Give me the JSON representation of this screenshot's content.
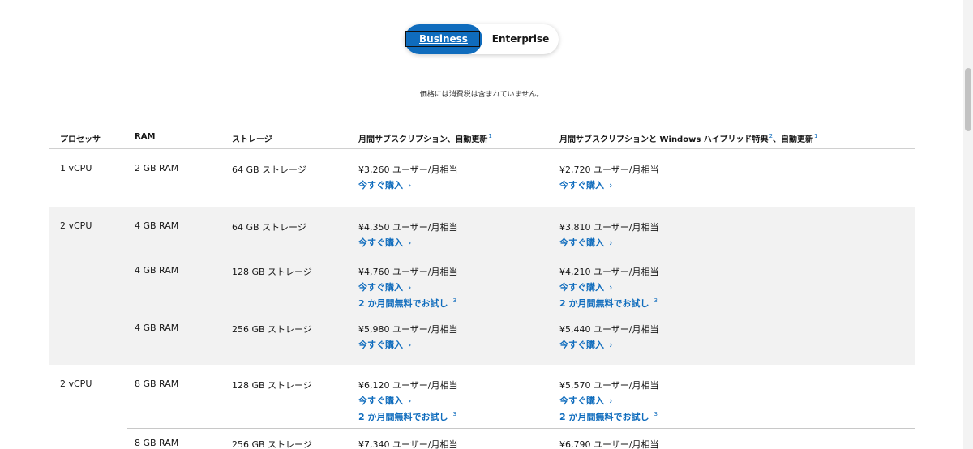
{
  "toggle": {
    "business_label": "Business",
    "enterprise_label": "Enterprise"
  },
  "note": "価格には消費税は含まれていません。",
  "table": {
    "headers": {
      "processor": "プロセッサ",
      "ram": "RAM",
      "storage": "ストレージ",
      "monthly": "月間サブスクリプション、自動更新",
      "monthly_sup": "1",
      "hybrid": "月間サブスクリプションと Windows ハイブリッド特典",
      "hybrid_sup1": "2",
      "hybrid_suffix": "、自動更新",
      "hybrid_sup2": "1"
    },
    "buy_label": "今すぐ購入",
    "chevron": "›",
    "trial_label": "2 か月間無料でお試し",
    "trial_sup": "3",
    "rows": [
      {
        "processor": "1 vCPU",
        "ram": "2 GB RAM",
        "storage": "64 GB ストレージ",
        "price1": "¥3,260 ユーザー/月相当",
        "price2": "¥2,720 ユーザー/月相当"
      },
      {
        "processor": "2 vCPU",
        "ram": "4 GB RAM",
        "storage": "64 GB ストレージ",
        "price1": "¥4,350 ユーザー/月相当",
        "price2": "¥3,810 ユーザー/月相当"
      },
      {
        "ram": "4 GB RAM",
        "storage": "128 GB ストレージ",
        "price1": "¥4,760 ユーザー/月相当",
        "price2": "¥4,210 ユーザー/月相当"
      },
      {
        "ram": "4 GB RAM",
        "storage": "256 GB ストレージ",
        "price1": "¥5,980 ユーザー/月相当",
        "price2": "¥5,440 ユーザー/月相当"
      },
      {
        "processor": "2 vCPU",
        "ram": "8 GB RAM",
        "storage": "128 GB ストレージ",
        "price1": "¥6,120 ユーザー/月相当",
        "price2": "¥5,570 ユーザー/月相当"
      },
      {
        "ram": "8 GB RAM",
        "storage": "256 GB ストレージ",
        "price1": "¥7,340 ユーザー/月相当",
        "price2": "¥6,790 ユーザー/月相当"
      }
    ]
  },
  "colors": {
    "accent": "#0f6cbd",
    "shaded_row": "#f2f2f2"
  }
}
